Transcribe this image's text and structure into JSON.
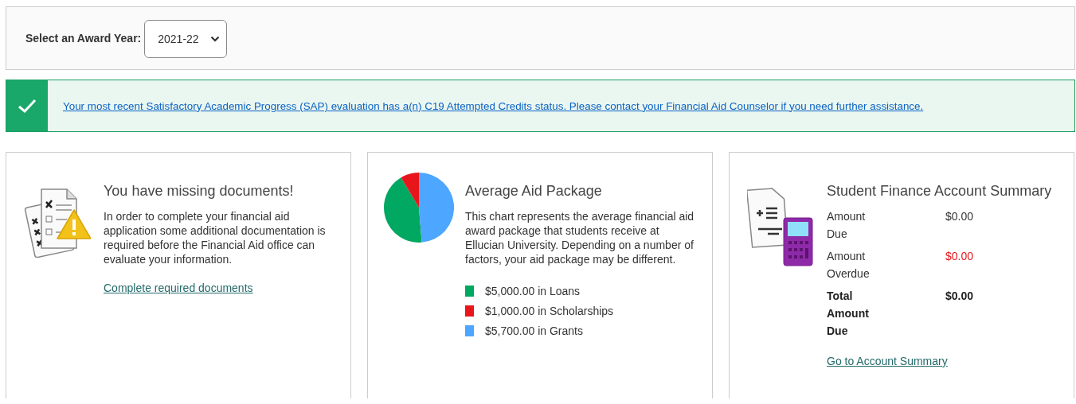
{
  "award_year": {
    "label": "Select an Award Year:",
    "value": "2021-22"
  },
  "banner": {
    "message": "Your most recent Satisfactory Academic Progress (SAP) evaluation has a(n) C19 Attempted Credits status. Please contact your Financial Aid Counselor if you need further assistance."
  },
  "cards": [
    {
      "kind": "documents",
      "title": "You have missing documents!",
      "body": "In order to complete your financial aid application some additional documentation is required before the Financial Aid office can evaluate your information.",
      "link": "Complete required documents"
    },
    {
      "kind": "chart",
      "title": "Average Aid Package",
      "body": "This chart represents the average financial aid award package that students receive at Ellucian University. Depending on a number of factors, your aid package may be different.",
      "chart_data": {
        "type": "pie",
        "values": [
          42.74,
          8.55,
          48.71
        ]
      },
      "legend": [
        {
          "text": "$5,000.00 in Loans",
          "color": "#00a862"
        },
        {
          "text": "$1,000.00 in Scholarships",
          "color": "#e8161b"
        },
        {
          "text": "$5,700.00 in Grants",
          "color": "#4da6ff"
        }
      ]
    },
    {
      "kind": "account",
      "title": "Student Finance Account Summary",
      "rows": [
        {
          "kind": "normal",
          "label": "Amount Due",
          "value": "$0.00"
        },
        {
          "kind": "overdue",
          "label": "Amount Overdue",
          "value": "$0.00"
        },
        {
          "kind": "total",
          "label": "Total Amount Due",
          "value": "$0.00"
        }
      ],
      "link": "Go to Account Summary"
    }
  ]
}
